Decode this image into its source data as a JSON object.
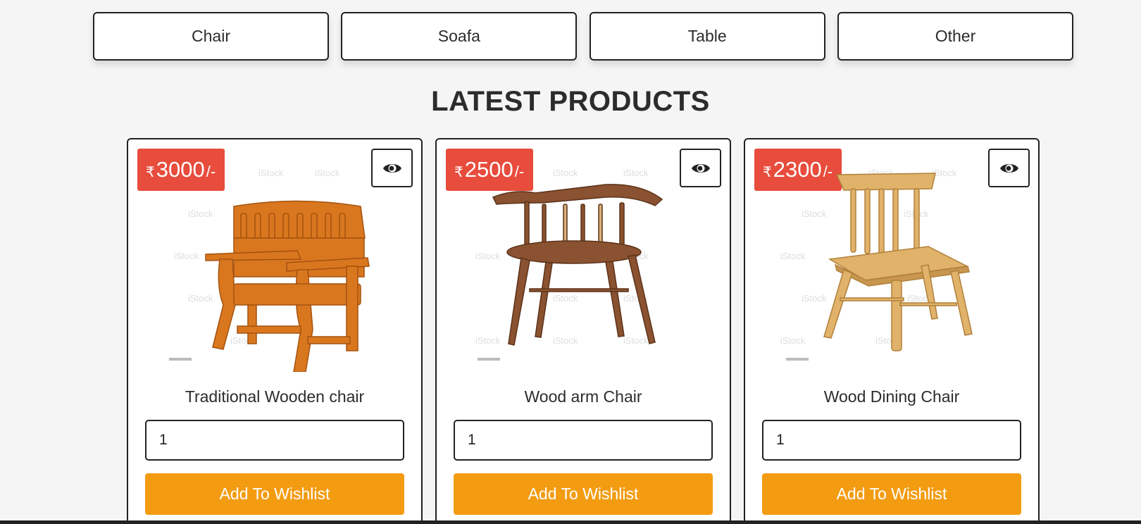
{
  "categories": [
    "Chair",
    "Soafa",
    "Table",
    "Other"
  ],
  "heading": "LATEST PRODUCTS",
  "currency_symbol": "₹",
  "price_suffix": "/-",
  "products": [
    {
      "price": "3000",
      "name": "Traditional Wooden chair",
      "quantity": "1",
      "button": "Add To Wishlist"
    },
    {
      "price": "2500",
      "name": "Wood arm Chair",
      "quantity": "1",
      "button": "Add To Wishlist"
    },
    {
      "price": "2300",
      "name": "Wood Dining Chair",
      "quantity": "1",
      "button": "Add To Wishlist"
    }
  ],
  "colors": {
    "price_badge": "#e74c3c",
    "wishlist_button": "#f39c12",
    "background": "#f5f5f5"
  },
  "icons": {
    "view": "eye-icon"
  }
}
